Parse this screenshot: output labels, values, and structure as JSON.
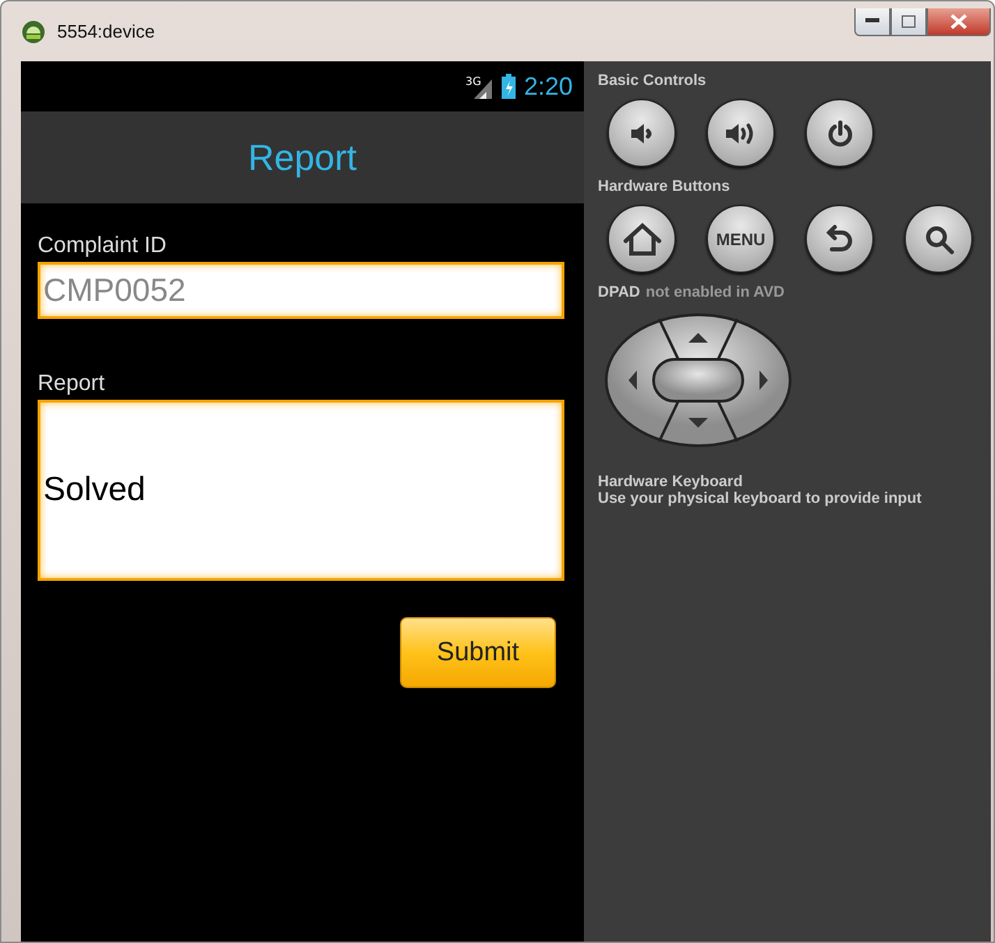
{
  "window": {
    "title": "5554:device"
  },
  "status_bar": {
    "network": "3G",
    "time": "2:20"
  },
  "action_bar": {
    "title": "Report"
  },
  "form": {
    "fields": [
      {
        "kind": "line",
        "label": "Complaint ID",
        "value": "CMP0052",
        "editable": false
      },
      {
        "kind": "multiline",
        "label": "Report",
        "value": "Solved",
        "editable": true
      }
    ],
    "submit": "Submit"
  },
  "controls": {
    "basic_title": "Basic Controls",
    "basic_buttons": [
      {
        "kind": "volume-down"
      },
      {
        "kind": "volume-up"
      },
      {
        "kind": "power"
      }
    ],
    "hardware_title": "Hardware Buttons",
    "hardware_buttons": [
      {
        "kind": "home"
      },
      {
        "kind": "menu",
        "label": "MENU"
      },
      {
        "kind": "back"
      },
      {
        "kind": "search"
      }
    ],
    "dpad_label": "DPAD",
    "dpad_note": "not enabled in AVD",
    "keyboard_title": "Hardware Keyboard",
    "keyboard_note": "Use your physical keyboard to provide input"
  }
}
